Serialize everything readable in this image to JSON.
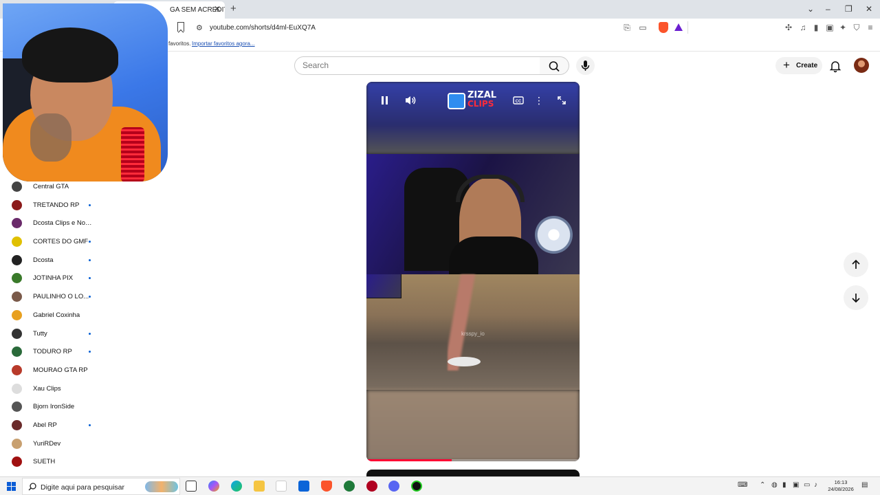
{
  "browser": {
    "tab_title": "GA SEM ACREDITAR N",
    "url": "youtube.com/shorts/d4ml-EuXQ7A",
    "bookmarks_text": "favoritos.",
    "bookmarks_link": "Importar favoritos agora..."
  },
  "masthead": {
    "search_placeholder": "Search",
    "create_label": "Create"
  },
  "subscriptions": [
    {
      "name": "Central GTA",
      "new": false,
      "color": "#444444"
    },
    {
      "name": "TRETANDO RP",
      "new": true,
      "color": "#8b1a1a"
    },
    {
      "name": "Dcosta Clips e Notí...",
      "new": false,
      "color": "#6a2a6a"
    },
    {
      "name": "CORTES DO GMF",
      "new": true,
      "color": "#e0c000"
    },
    {
      "name": "Dcosta",
      "new": true,
      "color": "#222222"
    },
    {
      "name": "JOTINHA PIX",
      "new": true,
      "color": "#3a7a2a"
    },
    {
      "name": "PAULINHO O LO...",
      "new": true,
      "color": "#7a5a4a"
    },
    {
      "name": "Gabriel Coxinha",
      "new": false,
      "color": "#e8a020"
    },
    {
      "name": "Tutty",
      "new": true,
      "color": "#333333"
    },
    {
      "name": "TODURO RP",
      "new": true,
      "color": "#2a6a3a"
    },
    {
      "name": "MOURAO GTA RP",
      "new": false,
      "color": "#b83a2a"
    },
    {
      "name": "Xau Clips",
      "new": false,
      "color": "#dddddd"
    },
    {
      "name": "Bjorn IronSide",
      "new": false,
      "color": "#555555"
    },
    {
      "name": "Abel RP",
      "new": true,
      "color": "#6a2a2a"
    },
    {
      "name": "YuriRDev",
      "new": false,
      "color": "#c8a070"
    },
    {
      "name": "SUETH",
      "new": false,
      "color": "#a01010"
    }
  ],
  "player": {
    "logo_line1": "ZIZAL",
    "logo_line2": "CLIPS",
    "watermark": "krsspy_io",
    "progress": 0.4
  },
  "taskbar": {
    "search_placeholder": "Digite aqui para pesquisar",
    "time": "16:13",
    "date": "24/08/2026"
  },
  "colors": {
    "accent_blue": "#065fd4",
    "progress_red": "#ff0033"
  }
}
